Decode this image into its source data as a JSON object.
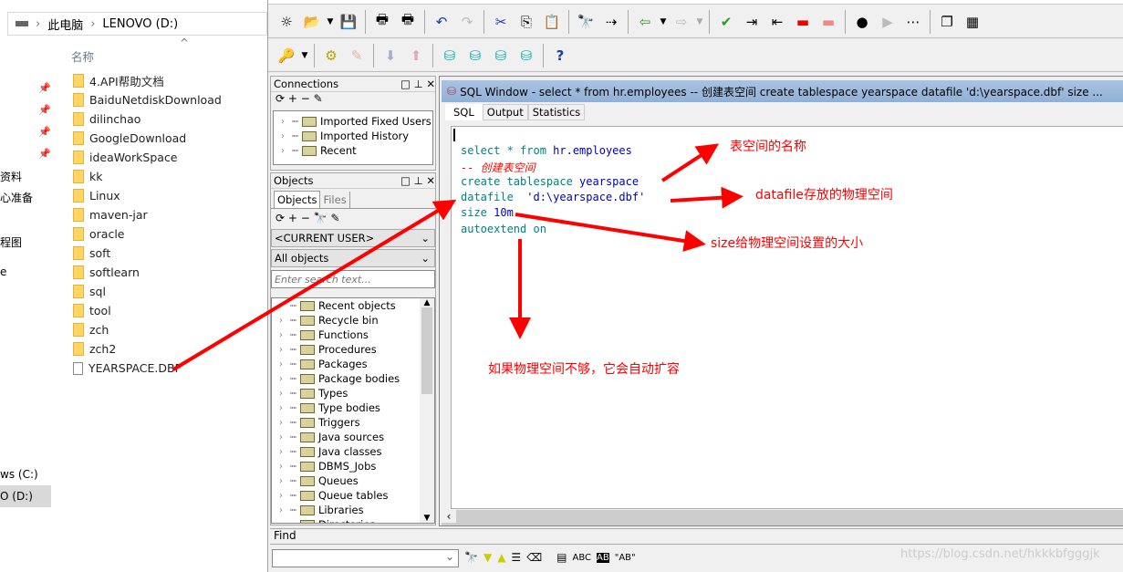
{
  "explorer": {
    "breadcrumb": [
      "此电脑",
      "LENOVO (D:)"
    ],
    "column_header": "名称",
    "nav_partial": [
      "资料",
      "心准备",
      "程图",
      "e",
      "ws (C:)",
      "O (D:)"
    ],
    "items": [
      {
        "name": "4.API帮助文档",
        "type": "folder"
      },
      {
        "name": "BaiduNetdiskDownload",
        "type": "folder"
      },
      {
        "name": "dilinchao",
        "type": "folder"
      },
      {
        "name": "GoogleDownload",
        "type": "folder"
      },
      {
        "name": "ideaWorkSpace",
        "type": "folder"
      },
      {
        "name": "kk",
        "type": "folder"
      },
      {
        "name": "Linux",
        "type": "folder"
      },
      {
        "name": "maven-jar",
        "type": "folder"
      },
      {
        "name": "oracle",
        "type": "folder"
      },
      {
        "name": "soft",
        "type": "folder"
      },
      {
        "name": "softlearn",
        "type": "folder"
      },
      {
        "name": "sql",
        "type": "folder"
      },
      {
        "name": "tool",
        "type": "folder"
      },
      {
        "name": "zch",
        "type": "folder"
      },
      {
        "name": "zch2",
        "type": "folder"
      },
      {
        "name": "YEARSPACE.DBF",
        "type": "file"
      }
    ]
  },
  "connections": {
    "title": "Connections",
    "items": [
      "Imported Fixed Users",
      "Imported History",
      "Recent"
    ]
  },
  "objects": {
    "title": "Objects",
    "tabs": [
      "Objects",
      "Files"
    ],
    "user_select": "<CURRENT USER>",
    "filter_select": "All objects",
    "search_placeholder": "Enter search text...",
    "items": [
      "Recent objects",
      "Recycle bin",
      "Functions",
      "Procedures",
      "Packages",
      "Package bodies",
      "Types",
      "Type bodies",
      "Triggers",
      "Java sources",
      "Java classes",
      "DBMS_Jobs",
      "Queues",
      "Queue tables",
      "Libraries",
      "Directories"
    ]
  },
  "sql_window": {
    "title": "SQL Window - select * from hr.employees -- 创建表空间 create tablespace yearspace datafile 'd:\\yearspace.dbf' size ...",
    "tabs": [
      "SQL",
      "Output",
      "Statistics"
    ],
    "code": {
      "l1a": "select * from ",
      "l1b": "hr.employees",
      "l2": "-- 创建表空间",
      "l3a": "create tablespace ",
      "l3b": "yearspace",
      "l4a": "datafile  ",
      "l4b": "'d:\\yearspace.dbf'",
      "l5a": "size ",
      "l5b": "10m",
      "l6": "autoextend on"
    }
  },
  "annotations": {
    "name": "表空间的名称",
    "datafile": "datafile存放的物理空间",
    "size": "size给物理空间设置的大小",
    "autoextend": "如果物理空间不够，它会自动扩容"
  },
  "find": {
    "label": "Find",
    "buttons": [
      "ABC",
      "\"AB\""
    ]
  },
  "watermark": "https://blog.csdn.net/hkkkbfgggjk",
  "colors": {
    "annotation": "#ff0000",
    "keyword": "#008080",
    "identifier": "#0000c0",
    "title_bar": "#9db9d9"
  }
}
